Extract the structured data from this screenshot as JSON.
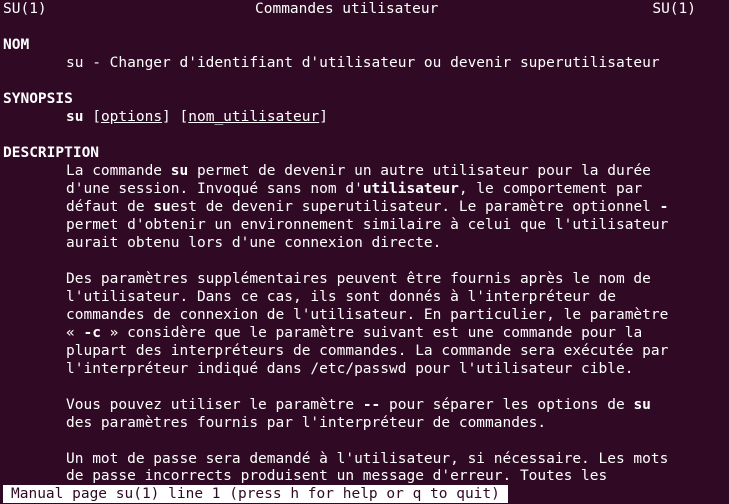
{
  "header": {
    "left": "SU(1)",
    "center": "Commandes utilisateur",
    "right": "SU(1)"
  },
  "sections": {
    "nom": {
      "title": "NOM",
      "text": "su - Changer d'identifiant d'utilisateur ou devenir superutilisateur"
    },
    "synopsis": {
      "title": "SYNOPSIS",
      "cmd": "su",
      "space1": " [",
      "options": "options",
      "mid": "] [",
      "user": "nom_utilisateur",
      "end": "]"
    },
    "description": {
      "title": "DESCRIPTION",
      "p1l1a": "La commande ",
      "p1l1b": "su",
      "p1l1c": " permet de devenir un autre utilisateur pour la durée",
      "p1l2a": "d'une session. Invoqué sans nom d'",
      "p1l2b": "utilisateur",
      "p1l2c": ", le comportement par",
      "p1l3a": "défaut de ",
      "p1l3b": "su",
      "p1l3c": "est de devenir superutilisateur. Le paramètre optionnel ",
      "p1l3d": "-",
      "p1l4": "permet d'obtenir un environnement similaire à celui que l'utilisateur",
      "p1l5": "aurait obtenu lors d'une connexion directe.",
      "p2l1": "Des paramètres supplémentaires peuvent être fournis après le nom de",
      "p2l2": "l'utilisateur. Dans ce cas, ils sont donnés à l'interpréteur de",
      "p2l3": "commandes de connexion de l'utilisateur. En particulier, le paramètre",
      "p2l4a": "« ",
      "p2l4b": "-c",
      "p2l4c": " » considère que le paramètre suivant est une commande pour la",
      "p2l5": "plupart des interpréteurs de commandes. La commande sera exécutée par",
      "p2l6": "l'interpréteur indiqué dans /etc/passwd pour l'utilisateur cible.",
      "p3l1a": "Vous pouvez utiliser le paramètre ",
      "p3l1b": "--",
      "p3l1c": " pour séparer les options de ",
      "p3l1d": "su",
      "p3l2": "des paramètres fournis par l'interpréteur de commandes.",
      "p4l1": "Un mot de passe sera demandé à l'utilisateur, si nécessaire. Les mots",
      "p4l2": "de passe incorrects produisent un message d'erreur. Toutes les"
    }
  },
  "status_bar": "Manual page su(1) line 1 (press h for help or q to quit)",
  "colors": {
    "background": "#300a24",
    "foreground": "#ffffff"
  }
}
